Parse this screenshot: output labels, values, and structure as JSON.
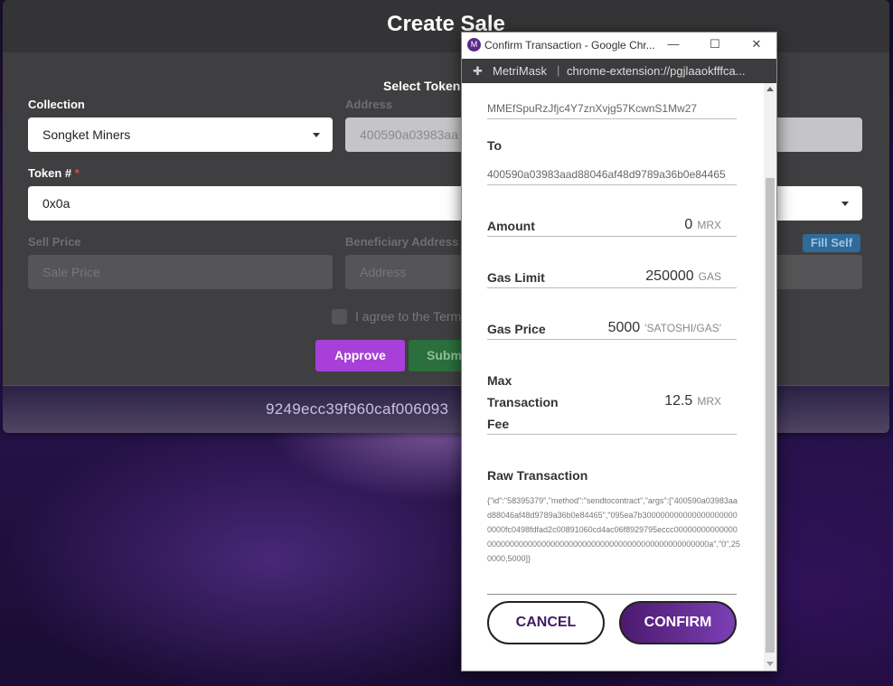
{
  "app": {
    "title": "Create Sale",
    "subtitle": "Select Token",
    "footer_hash": "9249ecc39f960caf006093"
  },
  "form": {
    "collection_label": "Collection",
    "collection_value": "Songket Miners",
    "address_label": "Address",
    "address_value": "400590a03983aa",
    "token_label": "Token #",
    "token_required": "*",
    "token_value": "0x0a",
    "sell_price_label": "Sell Price",
    "sell_price_placeholder": "Sale Price",
    "beneficiary_label": "Beneficiary Address",
    "beneficiary_placeholder": "Address",
    "fill_self_label": "Fill Self",
    "agree_label": "I agree to the Term",
    "approve_label": "Approve",
    "submit_label": "Subm"
  },
  "popup": {
    "window_title": "Confirm Transaction - Google Chr...",
    "extension_name": "MetriMask",
    "url": "chrome-extension://pgjlaaokfffca...",
    "from_address": "MMEfSpuRzJfjc4Y7znXvjg57KcwnS1Mw27",
    "to_label": "To",
    "to_address": "400590a03983aad88046af48d9789a36b0e84465",
    "amount_label": "Amount",
    "amount_value": "0",
    "amount_unit": "MRX",
    "gas_limit_label": "Gas Limit",
    "gas_limit_value": "250000",
    "gas_limit_unit": "GAS",
    "gas_price_label": "Gas Price",
    "gas_price_value": "5000",
    "gas_price_unit": "'SATOSHI/GAS'",
    "max_fee_label_1": "Max",
    "max_fee_label_2": "Transaction",
    "max_fee_label_3": "Fee",
    "max_fee_value": "12.5",
    "max_fee_unit": "MRX",
    "raw_label": "Raw Transaction",
    "raw_text": "{\"id\":\"58395379\",\"method\":\"sendtocontract\",\"args\":[\"400590a03983aad88046af48d9789a36b0e84465\",\"095ea7b3000000000000000000000000fc0498fdfad2c00891060cd4ac06f8929795eccc000000000000000000000000000000000000000000000000000000000000000a\",\"0\",250000,5000]}",
    "cancel_label": "CANCEL",
    "confirm_label": "CONFIRM",
    "minimize_icon": "—",
    "maximize_icon": "☐",
    "close_icon": "✕"
  }
}
